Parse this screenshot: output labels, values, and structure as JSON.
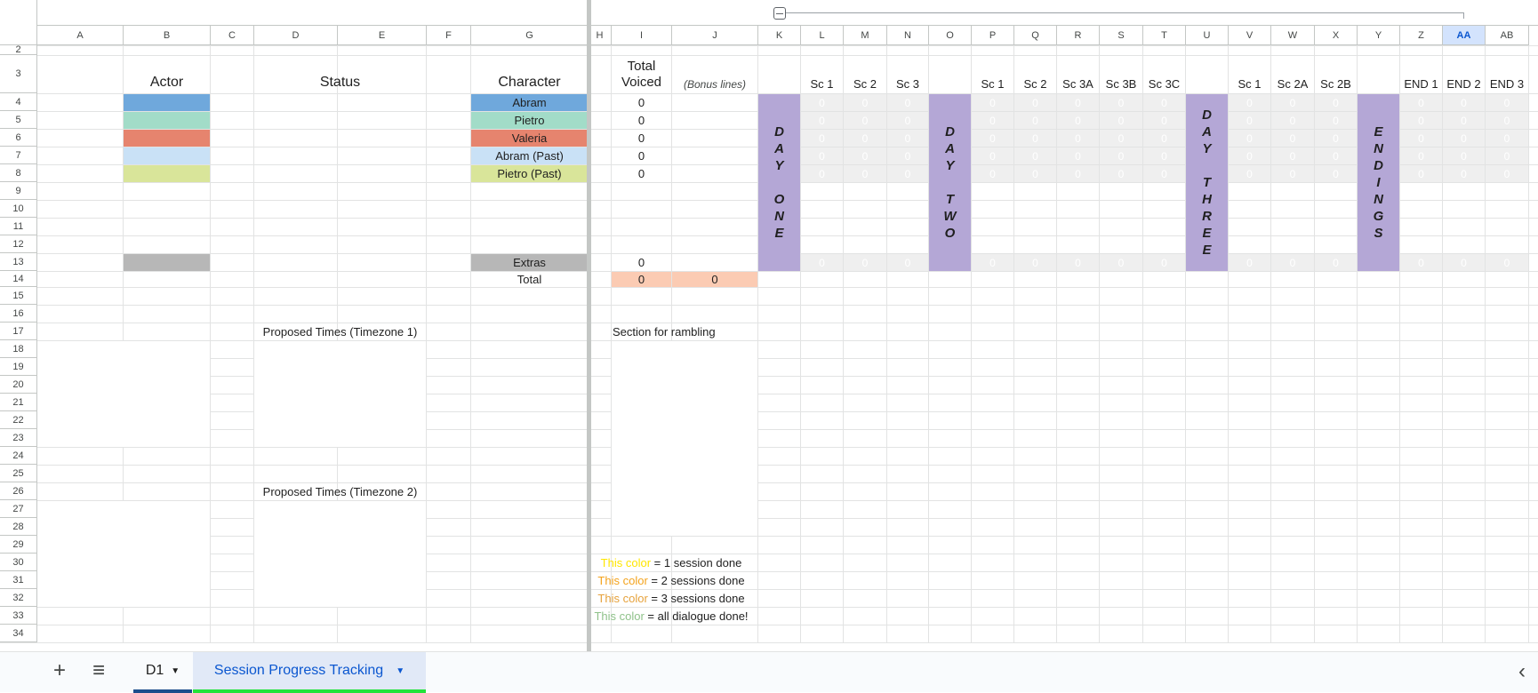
{
  "columns": [
    "A",
    "B",
    "C",
    "D",
    "E",
    "F",
    "G",
    "H",
    "I",
    "J",
    "K",
    "L",
    "M",
    "N",
    "O",
    "P",
    "Q",
    "R",
    "S",
    "T",
    "U",
    "V",
    "W",
    "X",
    "Y",
    "Z",
    "AA",
    "AB"
  ],
  "selected_column": "AA",
  "rows": [
    "2",
    "3",
    "4",
    "5",
    "6",
    "7",
    "8",
    "9",
    "10",
    "11",
    "12",
    "13",
    "14",
    "15",
    "16",
    "17",
    "18",
    "19",
    "20",
    "21",
    "22",
    "23",
    "24",
    "25",
    "26",
    "27",
    "28",
    "29",
    "30",
    "31",
    "32",
    "33",
    "34"
  ],
  "headers": {
    "actor": "Actor",
    "status": "Status",
    "character": "Character",
    "total_voiced_1": "Total",
    "total_voiced_2": "Voiced",
    "bonus_lines": "(Bonus lines)"
  },
  "scene_headers": [
    "Sc 1",
    "Sc 2",
    "Sc 3",
    "Sc 1",
    "Sc 2",
    "Sc 3A",
    "Sc 3B",
    "Sc 3C",
    "Sc 1",
    "Sc 2A",
    "Sc 2B",
    "END 1",
    "END 2",
    "END 3"
  ],
  "day_bars": {
    "day_one": [
      "D",
      "A",
      "Y",
      "",
      "O",
      "N",
      "E"
    ],
    "day_two": [
      "D",
      "A",
      "Y",
      "",
      "T",
      "W",
      "O"
    ],
    "day_three": [
      "D",
      "A",
      "Y",
      "",
      "T",
      "H",
      "R",
      "E",
      "E"
    ],
    "endings": [
      "E",
      "N",
      "D",
      "I",
      "N",
      "G",
      "S"
    ]
  },
  "characters": [
    {
      "name": "Abram",
      "color": "#6fa8dc",
      "voiced": "0"
    },
    {
      "name": "Pietro",
      "color": "#a2dcc8",
      "voiced": "0"
    },
    {
      "name": "Valeria",
      "color": "#e6846e",
      "voiced": "0"
    },
    {
      "name": "Abram (Past)",
      "color": "#c9e1f6",
      "voiced": "0"
    },
    {
      "name": "Pietro (Past)",
      "color": "#d9e59a",
      "voiced": "0"
    }
  ],
  "extras": {
    "name": "Extras",
    "color": "#b7b7b7",
    "voiced": "0"
  },
  "total": {
    "label": "Total",
    "voiced": "0",
    "bonus": "0",
    "color": "#fbcbb3"
  },
  "grid_zero": "0",
  "proposed_tz1": "Proposed Times (Timezone 1)",
  "proposed_tz2": "Proposed Times (Timezone 2)",
  "rambling": "Section for rambling",
  "legend": [
    {
      "color_word": "This color",
      "rest": " = 1 session done",
      "color": "#ffe600"
    },
    {
      "color_word": "This color",
      "rest": " = 2 sessions done",
      "color": "#f4a31c"
    },
    {
      "color_word": "This color",
      "rest": " = 3 sessions done",
      "color": "#e6a23c"
    },
    {
      "color_word": "This color",
      "rest": " = all dialogue done!",
      "color": "#8fc28a"
    }
  ],
  "tabs": {
    "add_label": "+",
    "menu_label": "≡",
    "d1": "D1",
    "active": "Session Progress Tracking",
    "scroll_left": "‹"
  },
  "colors": {
    "day_bar": "#b4a7d6",
    "active_tab_text": "#0b57d0",
    "active_tab_underline": "#22e33a"
  }
}
